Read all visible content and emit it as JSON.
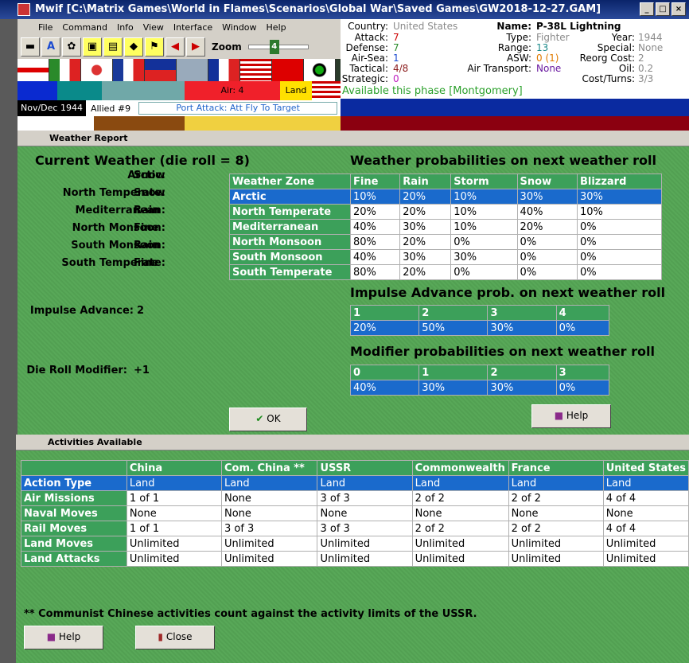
{
  "window": {
    "title": "Mwif [C:\\Matrix Games\\World in Flames\\Scenarios\\Global War\\Saved Games\\GW2018-12-27.GAM]"
  },
  "menu": [
    "File",
    "Command",
    "Info",
    "View",
    "Interface",
    "Window",
    "Help"
  ],
  "zoom": {
    "label": "Zoom",
    "value": "4"
  },
  "colorrow": {
    "air": "Air: 4",
    "land": "Land"
  },
  "status": {
    "date": "Nov/Dec 1944",
    "allied": "Allied #9",
    "port": "Port Attack: Att Fly To Target"
  },
  "unit": {
    "country_k": "Country:",
    "country": "United States",
    "attack_k": "Attack:",
    "attack": "7",
    "defense_k": "Defense:",
    "defense": "7",
    "airsea_k": "Air-Sea:",
    "airsea": "1",
    "tactical_k": "Tactical:",
    "tactical": "4/8",
    "strategic_k": "Strategic:",
    "strategic": "0",
    "name_k": "Name:",
    "name": "P-38L Lightning",
    "type_k": "Type:",
    "type": "Fighter",
    "range_k": "Range:",
    "range": "13",
    "asw_k": "ASW:",
    "asw": "0 (1)",
    "airtransport_k": "Air Transport:",
    "airtransport": "None",
    "year_k": "Year:",
    "year": "1944",
    "special_k": "Special:",
    "special": "None",
    "reorg_k": "Reorg Cost:",
    "reorg": "2",
    "oil_k": "Oil:",
    "oil": "0.2",
    "costturns_k": "Cost/Turns:",
    "costturns": "3/3",
    "available": "Available this phase [Montgomery]"
  },
  "weather": {
    "panel_title": "Weather Report",
    "current": "Current Weather (die roll = 8)",
    "zones": [
      {
        "label": "Arctic:",
        "value": "Snow"
      },
      {
        "label": "North Temperate:",
        "value": "Snow"
      },
      {
        "label": "Mediterranean:",
        "value": "Rain"
      },
      {
        "label": "North Monsoon:",
        "value": "Fine"
      },
      {
        "label": "South Monsoon:",
        "value": "Rain"
      },
      {
        "label": "South Temperate:",
        "value": "Fine"
      }
    ],
    "impulse_label": "Impulse Advance:",
    "impulse_value": "2",
    "dieroll_label": "Die Roll Modifier:",
    "dieroll_value": "+1",
    "prob_title": "Weather probabilities on next weather roll",
    "prob_headers": [
      "Weather Zone",
      "Fine",
      "Rain",
      "Storm",
      "Snow",
      "Blizzard"
    ],
    "prob_rows": [
      [
        "Arctic",
        "10%",
        "20%",
        "10%",
        "30%",
        "30%"
      ],
      [
        "North Temperate",
        "20%",
        "20%",
        "10%",
        "40%",
        "10%"
      ],
      [
        "Mediterranean",
        "40%",
        "30%",
        "10%",
        "20%",
        "0%"
      ],
      [
        "North Monsoon",
        "80%",
        "20%",
        "0%",
        "0%",
        "0%"
      ],
      [
        "South Monsoon",
        "40%",
        "30%",
        "30%",
        "0%",
        "0%"
      ],
      [
        "South Temperate",
        "80%",
        "20%",
        "0%",
        "0%",
        "0%"
      ]
    ],
    "impulse_title": "Impulse Advance prob. on next weather roll",
    "impulse_headers": [
      "1",
      "2",
      "3",
      "4"
    ],
    "impulse_row": [
      "20%",
      "50%",
      "30%",
      "0%"
    ],
    "mod_title": "Modifier probabilities on next weather roll",
    "mod_headers": [
      "0",
      "1",
      "2",
      "3"
    ],
    "mod_row": [
      "40%",
      "30%",
      "30%",
      "0%"
    ],
    "ok": "OK",
    "help": "Help"
  },
  "activities": {
    "panel_title": "Activities Available",
    "headers": [
      "",
      "China",
      "Com. China **",
      "USSR",
      "Commonwealth",
      "France",
      "United States"
    ],
    "rows": [
      [
        "Action Type",
        "Land",
        "Land",
        "Land",
        "Land",
        "Land",
        "Land"
      ],
      [
        "Air Missions",
        "1 of 1",
        "None",
        "3 of 3",
        "2 of 2",
        "2 of 2",
        "4 of 4"
      ],
      [
        "Naval Moves",
        "None",
        "None",
        "None",
        "None",
        "None",
        "None"
      ],
      [
        "Rail Moves",
        "1 of 1",
        "3 of 3",
        "3 of 3",
        "2 of 2",
        "2 of 2",
        "4 of 4"
      ],
      [
        "Land Moves",
        "Unlimited",
        "Unlimited",
        "Unlimited",
        "Unlimited",
        "Unlimited",
        "Unlimited"
      ],
      [
        "Land Attacks",
        "Unlimited",
        "Unlimited",
        "Unlimited",
        "Unlimited",
        "Unlimited",
        "Unlimited"
      ]
    ],
    "note": "** Communist Chinese activities count against the activity limits of the USSR.",
    "help": "Help",
    "close": "Close"
  },
  "colors": {
    "accent": "#3ca05a",
    "selected": "#1a6acc",
    "panel": "#58a858"
  }
}
